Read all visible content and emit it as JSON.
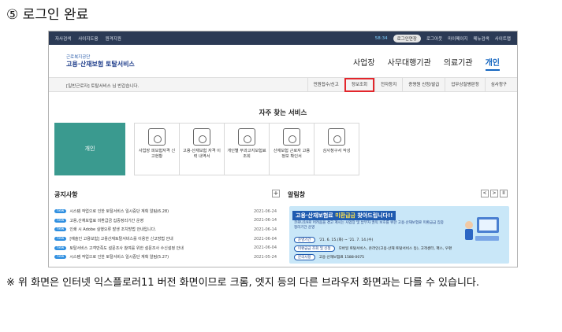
{
  "step_title": "⑤ 로그인 완료",
  "utilbar": {
    "left": [
      "자사검색",
      "사이지도움",
      "원격지원"
    ],
    "timer": "58:34",
    "extend": "로그인연장",
    "right": [
      "로그아웃",
      "마이페이지",
      "메뉴검색",
      "사이트맵"
    ]
  },
  "logo": {
    "sub": "근로복지공단",
    "main": "고용·산재보험 토탈서비스"
  },
  "topnav": [
    "사업장",
    "사무대행기관",
    "의료기관",
    "개인"
  ],
  "subbar": {
    "message": "[일반근로자] 토탈서비스 님 반갑습니다.",
    "menu": [
      "민원접수/신고",
      "정보조회",
      "전자등지",
      "증명원 신청/발급",
      "업무상질병판정",
      "심사청구"
    ]
  },
  "freq": {
    "title": "자주 찾는 서비스",
    "persona": "개인",
    "services": [
      "사업장 피보험자격 신고현황",
      "고용·산재보험 자격 이력 내역서",
      "개인별 부과고지보험료 조회",
      "산재보험 근로자 고용정보 확인서",
      "심사청구서 작성"
    ]
  },
  "notice": {
    "title": "공지사항",
    "plus": "+",
    "items": [
      {
        "badge": "new",
        "text": "시스템 작업으로 인한 토탈서비스 일시중단 계획 알림(6.28)",
        "date": "2021-06-24"
      },
      {
        "badge": "new",
        "text": "고용,산재보험료 미환급금 집중정리기간 운영",
        "date": "2021-06-14"
      },
      {
        "badge": "new",
        "text": "인쇄 시 Adobe 실행오류 발생 조치방법 안내입니다.",
        "date": "2021-06-14"
      },
      {
        "badge": "new",
        "text": "[예술인 고용보험] 고용산재토탈서비스를 이용한 신고방법 안내",
        "date": "2021-06-04"
      },
      {
        "badge": "new",
        "text": "토탈서비스 고객만족도 설문조사 참여를 위한 설문조사 수신설정 안내",
        "date": "2021-06-04"
      },
      {
        "badge": "new",
        "text": "시스템 작업으로 인한 토탈서비스 일시중단 계획 알림(5.27)",
        "date": "2021-05-24"
      }
    ]
  },
  "alert": {
    "title": "알림창",
    "prev": "<",
    "next": ">",
    "pause": "II",
    "banner_head": "고용·산재보험료 ",
    "banner_head_em": "미환급금",
    "banner_head_tail": " 찾아드립니다!!",
    "banner_desc": "코로나19로 어려움을 겪고 계시는 사업장 및 납부자 권익 보호를 위한 고용·산재보험료 미환급금 집중정리기간 운영",
    "rows": [
      {
        "label": "운영기간",
        "value": "'21. 6. 15.(화) ~ '21. 7. 14.(수)"
      },
      {
        "label": "미환급금 조회 및 신청",
        "value": "모바일 토탈서비스, 온라인(고용·산재 토탈서비스 등), 고객센터, 팩스, 우편"
      },
      {
        "label": "문의사항",
        "value": "고용·산재보험료 1588-0075"
      }
    ]
  },
  "footnote": "※ 위 화면은 인터넷 익스플로러11 버전 화면이므로 크롬, 엣지 등의 다른 브라우저 화면과는 다를 수 있습니다."
}
